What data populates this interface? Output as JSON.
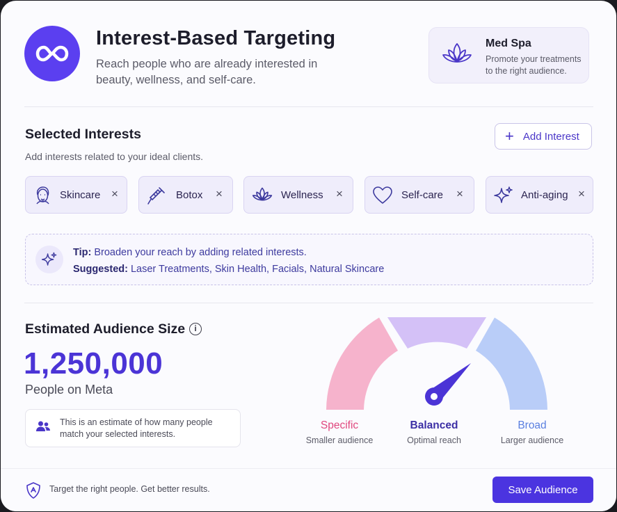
{
  "header": {
    "title": "Interest-Based Targeting",
    "subtitle": "Reach people who are already interested in beauty, wellness, and self-care.",
    "logo_icon": "meta-infinity-icon"
  },
  "business": {
    "name": "Med Spa",
    "description": "Promote your treatments to the right audience.",
    "icon": "lotus-icon"
  },
  "interests": {
    "title": "Selected Interests",
    "subtitle": "Add interests related to your ideal clients.",
    "add_label": "Add Interest",
    "chips": [
      {
        "label": "Skincare",
        "icon": "face-icon"
      },
      {
        "label": "Botox",
        "icon": "syringe-icon"
      },
      {
        "label": "Wellness",
        "icon": "lotus-icon"
      },
      {
        "label": "Self-care",
        "icon": "heart-icon"
      },
      {
        "label": "Anti-aging",
        "icon": "sparkle-icon"
      }
    ],
    "remove_symbol": "×"
  },
  "tip": {
    "label": "Tip:",
    "text": "Broaden your reach by adding related interests.",
    "suggested_label": "Suggested:",
    "suggestions": [
      "Laser Treatments",
      "Skin Health",
      "Facials",
      "Natural Skincare"
    ]
  },
  "audience": {
    "title": "Estimated Audience Size",
    "info_symbol": "i",
    "size": "1,250,000",
    "unit": "People on Meta",
    "note": "This is an estimate of how many people match your selected interests.",
    "gauge": {
      "specific_label": "Specific",
      "specific_sub": "Smaller audience",
      "balanced_label": "Balanced",
      "balanced_sub": "Optimal reach",
      "broad_label": "Broad",
      "broad_sub": "Larger audience",
      "colors": {
        "specific": "#f6b3cc",
        "balanced": "#d4c1f7",
        "broad": "#b9cdf8",
        "needle": "#4b34d6"
      }
    }
  },
  "footer": {
    "text": "Target the right people. Get better results.",
    "save_label": "Save Audience"
  },
  "colors": {
    "accent": "#4b34e0",
    "background": "#fbfbfe"
  }
}
